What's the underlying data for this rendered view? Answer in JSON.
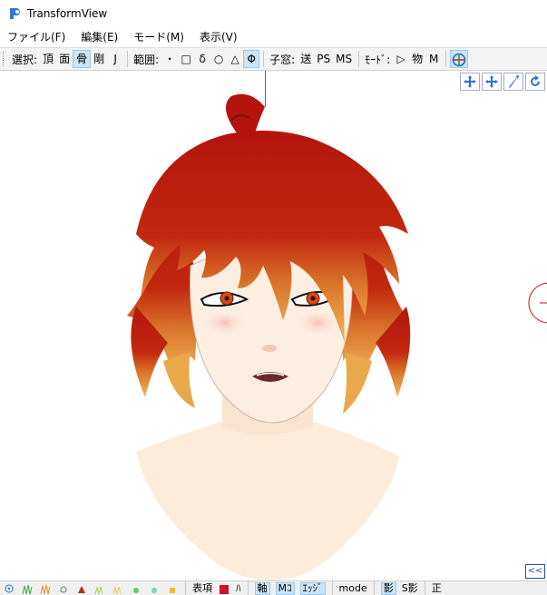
{
  "window": {
    "title": "TransformView"
  },
  "menu": [
    "ファイル(F)",
    "編集(E)",
    "モード(M)",
    "表示(V)"
  ],
  "toolbar": {
    "select_label": "選択:",
    "select_items": [
      "頂",
      "面",
      "骨",
      "剛",
      "J"
    ],
    "select_active": "骨",
    "range_label": "範囲:",
    "range_items": [
      "・",
      "□",
      "δ",
      "○",
      "△",
      "Φ"
    ],
    "range_active": "Φ",
    "window_label": "子窓:",
    "window_items": [
      "送",
      "PS",
      "MS"
    ],
    "mode_label": "ﾓｰﾄﾞ:",
    "mode_items": [
      "▷",
      "物",
      "M"
    ]
  },
  "viewport": {
    "nav_icons": [
      "move-xy-icon",
      "move-xz-icon",
      "rotate-icon",
      "refresh-icon"
    ],
    "collapse_label": "<<"
  },
  "bottombar": {
    "texts": [
      "表項",
      "ﾊ",
      "軸",
      "Mｺ",
      "ｴｯｼﾞ",
      "mode",
      "影",
      "S影",
      "正"
    ]
  },
  "colors": {
    "hair_top": "#b3150e",
    "hair_tip": "#e8a23a",
    "skin": "#fbe6d6",
    "accent": "#cce4f7"
  }
}
